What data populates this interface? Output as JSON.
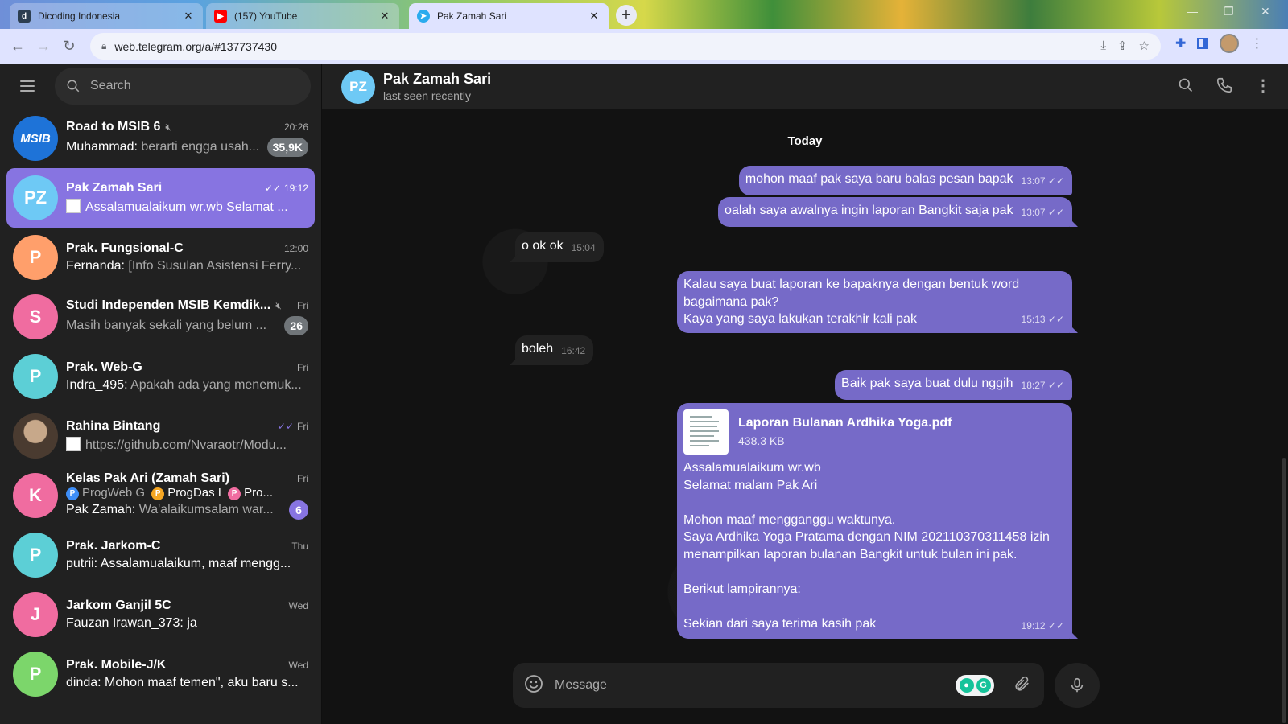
{
  "browser": {
    "tabs": [
      {
        "label": "Dicoding Indonesia",
        "icon": "dicoding-icon",
        "color": "#2d3e50"
      },
      {
        "label": "(157) YouTube",
        "icon": "youtube-icon",
        "color": "#ff0000"
      },
      {
        "label": "Pak Zamah Sari",
        "icon": "telegram-icon",
        "color": "#2aabee",
        "active": true
      }
    ],
    "url": "web.telegram.org/a/#137737430"
  },
  "sidebar": {
    "search_placeholder": "Search",
    "chats": [
      {
        "name": "Road to MSIB 6",
        "time": "20:26",
        "sender": "Muhammad",
        "text": "berarti engga usah...",
        "badge": "35,9K",
        "muted": true,
        "avatar_text": "MSIB",
        "avatar_color": "#1e73d8"
      },
      {
        "name": "Pak Zamah Sari",
        "time": "19:12",
        "sender": "",
        "text": "Assalamualaikum wr.wb Selamat ...",
        "avatar_text": "PZ",
        "avatar_color": "#6ec9f5",
        "active": true,
        "read": true,
        "doc": true
      },
      {
        "name": "Prak. Fungsional-C",
        "time": "12:00",
        "sender": "Fernanda",
        "text": "[Info Susulan Asistensi Ferry...",
        "avatar_text": "P",
        "avatar_color": "#ff9f6b"
      },
      {
        "name": "Studi Independen MSIB Kemdik...",
        "time": "Fri",
        "sender": "",
        "text": "Masih banyak sekali yang belum ...",
        "badge": "26",
        "muted": true,
        "avatar_text": "S",
        "avatar_color": "#f06ca0"
      },
      {
        "name": "Prak. Web-G",
        "time": "Fri",
        "sender": "Indra_495",
        "text": "Apakah ada yang menemuk...",
        "avatar_text": "P",
        "avatar_color": "#5ccfd6"
      },
      {
        "name": "Rahina Bintang",
        "time": "Fri",
        "sender": "",
        "text": "https://github.com/Nvaraotr/Modu...",
        "avatar_text": "",
        "avatar_color": "#6b5a4a",
        "read": true,
        "doc": true
      },
      {
        "name": "Kelas Pak Ari (Zamah Sari)",
        "time": "Fri",
        "sender": "Pak Zamah",
        "text": "Wa'alaikumsalam war...",
        "badge": "6",
        "badge_purple": true,
        "avatar_text": "K",
        "avatar_color": "#f06ca0",
        "topics": [
          {
            "dot": "P",
            "color": "#3e8ef7",
            "label": "ProgWeb G"
          },
          {
            "dot": "P",
            "color": "#f5a623",
            "label": "ProgDas I"
          },
          {
            "dot": "P",
            "color": "#f06ca0",
            "label": "Pro..."
          }
        ]
      },
      {
        "name": "Prak. Jarkom-C",
        "time": "Thu",
        "sender": "",
        "text": "putrii: Assalamualaikum, maaf mengg...",
        "avatar_text": "P",
        "avatar_color": "#5ccfd6"
      },
      {
        "name": "Jarkom Ganjil 5C",
        "time": "Wed",
        "sender": "",
        "text": "Fauzan Irawan_373: ja",
        "avatar_text": "J",
        "avatar_color": "#f06ca0"
      },
      {
        "name": "Prak. Mobile-J/K",
        "time": "Wed",
        "sender": "",
        "text": "dinda: Mohon maaf temen\", aku baru s...",
        "avatar_text": "P",
        "avatar_color": "#7cd66b"
      }
    ]
  },
  "chat": {
    "peer_name": "Pak Zamah Sari",
    "peer_initials": "PZ",
    "peer_status": "last seen recently",
    "day_label": "Today",
    "messages": {
      "m1": {
        "text": "mohon maaf pak saya baru balas pesan bapak",
        "time": "13:07"
      },
      "m2": {
        "text": "oalah saya awalnya ingin laporan Bangkit saja pak",
        "time": "13:07"
      },
      "m3": {
        "text": "o ok ok",
        "time": "15:04"
      },
      "m4": {
        "lines": [
          "Kalau saya buat laporan ke bapaknya dengan bentuk word",
          "bagaimana pak?",
          "Kaya yang saya lakukan terakhir kali pak"
        ],
        "time": "15:13"
      },
      "m5": {
        "text": "boleh",
        "time": "16:42"
      },
      "m6": {
        "text": "Baik pak saya buat dulu nggih",
        "time": "18:27"
      },
      "m7": {
        "file_name": "Laporan Bulanan Ardhika Yoga.pdf",
        "file_size": "438.3 KB",
        "lines": [
          "Assalamualaikum wr.wb",
          "Selamat malam Pak Ari",
          "",
          "Mohon maaf mengganggu waktunya.",
          "Saya Ardhika Yoga Pratama dengan NIM 202110370311458 izin",
          "menampilkan laporan bulanan Bangkit untuk bulan ini pak.",
          "",
          "Berikut lampirannya:",
          "",
          "Sekian dari saya terima kasih pak"
        ],
        "time": "19:12"
      }
    },
    "composer_placeholder": "Message"
  },
  "colors": {
    "accent": "#8774e1",
    "outgoing": "#766ac8",
    "sidebar": "#212121"
  }
}
